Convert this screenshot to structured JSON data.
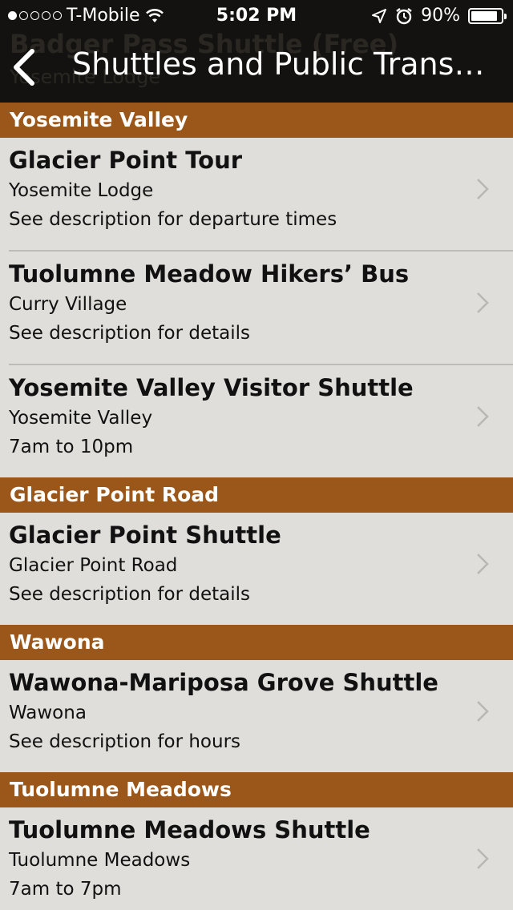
{
  "status_bar": {
    "carrier": "T-Mobile",
    "time": "5:02 PM",
    "battery": "90%",
    "battery_level": 0.9,
    "signal_bars_filled": 1,
    "signal_bars_total": 5
  },
  "ghost": {
    "line1": "Badger Pass Shuttle (Free)",
    "line2": "Yosemite Lodge"
  },
  "nav": {
    "back_icon": "chevron-left-icon",
    "title": "Shuttles and Public Transportation"
  },
  "sections": [
    {
      "header": "Yosemite Valley",
      "items": [
        {
          "title": "Glacier Point Tour",
          "location": "Yosemite Lodge",
          "detail": "See description for departure times"
        },
        {
          "title": "Tuolumne Meadow Hikers’ Bus",
          "location": "Curry Village",
          "detail": "See description for details"
        },
        {
          "title": "Yosemite Valley Visitor Shuttle",
          "location": "Yosemite Valley",
          "detail": "7am to 10pm"
        }
      ]
    },
    {
      "header": "Glacier Point Road",
      "items": [
        {
          "title": "Glacier Point Shuttle",
          "location": "Glacier Point Road",
          "detail": "See description for details"
        }
      ]
    },
    {
      "header": "Wawona",
      "items": [
        {
          "title": "Wawona-Mariposa Grove Shuttle",
          "location": "Wawona",
          "detail": "See description for hours"
        }
      ]
    },
    {
      "header": "Tuolumne Meadows",
      "items": [
        {
          "title": "Tuolumne Meadows Shuttle",
          "location": "Tuolumne Meadows",
          "detail": "7am to 7pm"
        }
      ]
    }
  ],
  "colors": {
    "section_header": "#9b571a",
    "list_background": "#dfdeda",
    "nav_background": "#131210"
  }
}
